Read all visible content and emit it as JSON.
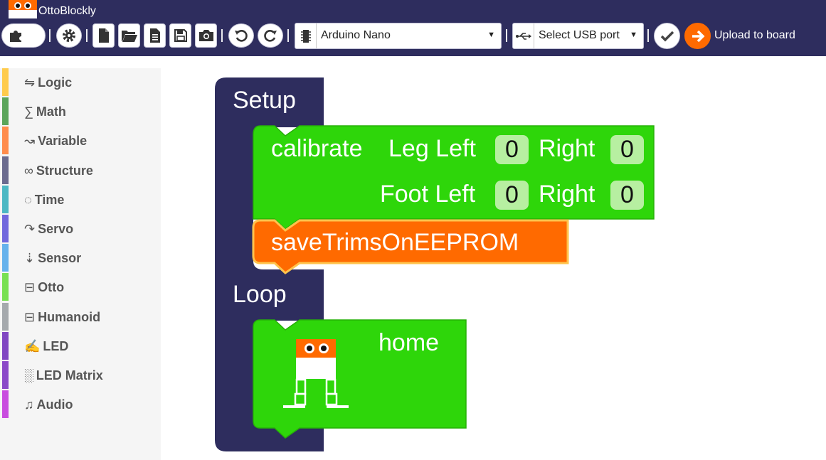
{
  "app": {
    "title": "OttoBlockly"
  },
  "toolbar": {
    "board_select": {
      "value": "Arduino Nano"
    },
    "port_select": {
      "value": "Select USB port"
    },
    "upload_label": "Upload to board",
    "icons": [
      "puzzle-icon",
      "gear-icon",
      "new-file-icon",
      "open-folder-icon",
      "code-file-icon",
      "save-icon",
      "camera-icon",
      "undo-icon",
      "redo-icon",
      "chip-icon",
      "usb-icon",
      "check-icon",
      "upload-arrow-icon"
    ]
  },
  "sidebar": {
    "items": [
      {
        "glyph": "⇋",
        "label": "Logic",
        "color": "#ffcb4c"
      },
      {
        "glyph": "∑",
        "label": "Math",
        "color": "#5ba55b"
      },
      {
        "glyph": "↝",
        "label": "Variable",
        "color": "#ff8c4c"
      },
      {
        "glyph": "∞",
        "label": "Structure",
        "color": "#6b6b8f"
      },
      {
        "glyph": "◌",
        "label": "Time",
        "color": "#4cb8c4"
      },
      {
        "glyph": "↷",
        "label": "Servo",
        "color": "#7168dd"
      },
      {
        "glyph": "⇣",
        "label": "Sensor",
        "color": "#66b2ec"
      },
      {
        "glyph": "⊟",
        "label": "Otto",
        "color": "#78e052"
      },
      {
        "glyph": "⊟",
        "label": "Humanoid",
        "color": "#a5a9ad"
      },
      {
        "glyph": "✍",
        "label": "LED",
        "color": "#8146c2"
      },
      {
        "glyph": "░",
        "label": "LED Matrix",
        "color": "#8b49c8"
      },
      {
        "glyph": "♫",
        "label": "Audio",
        "color": "#c94ddf"
      }
    ]
  },
  "workspace": {
    "setup_label": "Setup",
    "loop_label": "Loop",
    "calibrate": {
      "label": "calibrate",
      "leg_left_label": "Leg Left",
      "right_label": "Right",
      "foot_left_label": "Foot Left",
      "leg_left_value": "0",
      "leg_right_value": "0",
      "foot_left_value": "0",
      "foot_right_value": "0"
    },
    "save_trims_label": "saveTrimsOnEEPROM",
    "home_label": "home"
  },
  "colors": {
    "header": "#2e2d5e",
    "setup_block": "#2e2d5e",
    "otto_block": "#2ed60a",
    "save_block": "#ff6a00",
    "save_border": "#ffc44d",
    "upload_accent": "#ff6a00"
  }
}
